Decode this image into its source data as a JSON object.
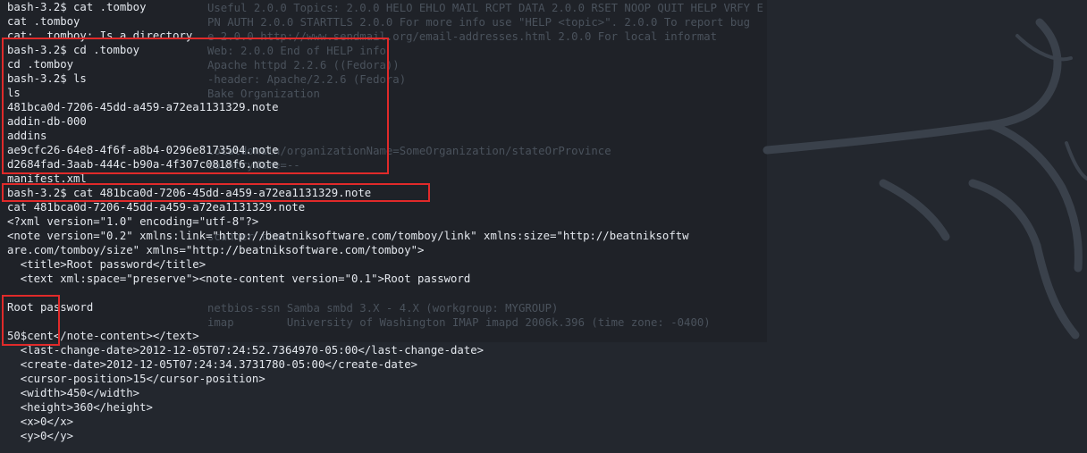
{
  "background_output": [
    {
      "row": 0,
      "text": "Useful 2.0.0 Topics: 2.0.0 HELO EHLO MAIL RCPT DATA 2.0.0 RSET NOOP QUIT HELP VRFY E"
    },
    {
      "row": 1,
      "text": "PN AUTH 2.0.0 STARTTLS 2.0.0 For more info use \"HELP <topic>\". 2.0.0 To report bug"
    },
    {
      "row": 2,
      "text": "e 2.0.0 http://www.sendmail.org/email-addresses.html 2.0.0 For local informat"
    },
    {
      "row": 3,
      "text": "Web: 2.0.0 End of HELP info"
    },
    {
      "row": 4,
      "text": "Apache httpd 2.2.6 ((Fedora))"
    },
    {
      "row": 5,
      "text": "-header: Apache/2.2.6 (Fedora)"
    },
    {
      "row": 6,
      "text": "Bake Organization"
    },
    {
      "row": 10,
      "text": "localdomain/organizationName=SomeOrganization/stateOrProvince"
    },
    {
      "row": 11,
      "text": "countryName=--"
    },
    {
      "row": 16,
      "text": "scanner time."
    },
    {
      "row": 21,
      "text": "netbios-ssn Samba smbd 3.X - 4.X (workgroup: MYGROUP)"
    },
    {
      "row": 22,
      "text": "imap        University of Washington IMAP imapd 2006k.396 (time zone: -0400)"
    }
  ],
  "terminal_lines": [
    "bash-3.2$ cat .tomboy",
    "cat .tomboy",
    "cat: .tomboy: Is a directory",
    "bash-3.2$ cd .tomboy",
    "cd .tomboy",
    "bash-3.2$ ls",
    "ls",
    "481bca0d-7206-45dd-a459-a72ea1131329.note",
    "addin-db-000",
    "addins",
    "ae9cfc26-64e8-4f6f-a8b4-0296e8173504.note",
    "d2684fad-3aab-444c-b90a-4f307c0818f6.note",
    "manifest.xml",
    "bash-3.2$ cat 481bca0d-7206-45dd-a459-a72ea1131329.note",
    "cat 481bca0d-7206-45dd-a459-a72ea1131329.note",
    "<?xml version=\"1.0\" encoding=\"utf-8\"?>",
    "<note version=\"0.2\" xmlns:link=\"http://beatniksoftware.com/tomboy/link\" xmlns:size=\"http://beatniksoftw",
    "are.com/tomboy/size\" xmlns=\"http://beatniksoftware.com/tomboy\">",
    "  <title>Root password</title>",
    "  <text xml:space=\"preserve\"><note-content version=\"0.1\">Root password",
    "",
    "Root password",
    "",
    "50$cent</note-content></text>",
    "  <last-change-date>2012-12-05T07:24:52.7364970-05:00</last-change-date>",
    "  <create-date>2012-12-05T07:24:34.3731780-05:00</create-date>",
    "  <cursor-position>15</cursor-position>",
    "  <width>450</width>",
    "  <height>360</height>",
    "  <x>0</x>",
    "  <y>0</y>"
  ],
  "colors": {
    "terminal_bg": "#23272e",
    "terminal_text": "#e4e8ee",
    "faded_text": "#4a525c",
    "annotation_red": "#e02a2a"
  }
}
